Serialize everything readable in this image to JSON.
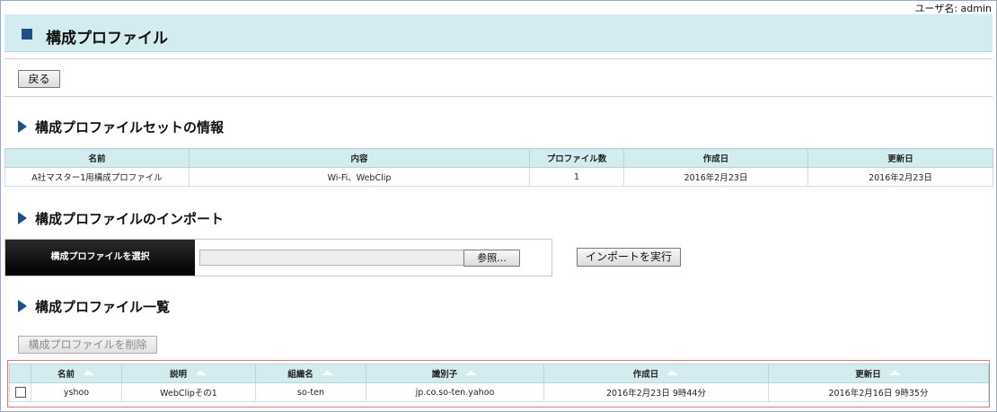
{
  "header": {
    "user_label": "ユーザ名: admin",
    "page_title": "構成プロファイル",
    "back_label": "戻る"
  },
  "sections": {
    "set_info_title": "構成プロファイルセットの情報",
    "import_title": "構成プロファイルのインポート",
    "list_title": "構成プロファイル一覧"
  },
  "set_info_table": {
    "columns": [
      "名前",
      "内容",
      "プロファイル数",
      "作成日",
      "更新日"
    ],
    "row": [
      "A社マスター1用構成プロファイル",
      "Wi-Fi、WebClip",
      "1",
      "2016年2月23日",
      "2016年2月23日"
    ]
  },
  "import": {
    "select_label": "構成プロファイルを選択",
    "file_value": "",
    "browse_label": "参照...",
    "execute_label": "インポートを実行"
  },
  "profile_list": {
    "delete_label": "構成プロファイルを削除",
    "columns": [
      "名前",
      "説明",
      "組織名",
      "識別子",
      "作成日",
      "更新日"
    ],
    "rows": [
      [
        "yshoo",
        "WebClipその1",
        "so-ten",
        "jp.co.so-ten.yahoo",
        "2016年2月23日 9時44分",
        "2016年2月16日 9時35分"
      ]
    ]
  },
  "colors": {
    "header_bg": "#d3ecef",
    "accent": "#1f4e86",
    "selection_border": "#e2787f"
  },
  "icons": [
    "square-icon",
    "triangle-right-icon",
    "sort-icon",
    "checkbox-icon"
  ]
}
